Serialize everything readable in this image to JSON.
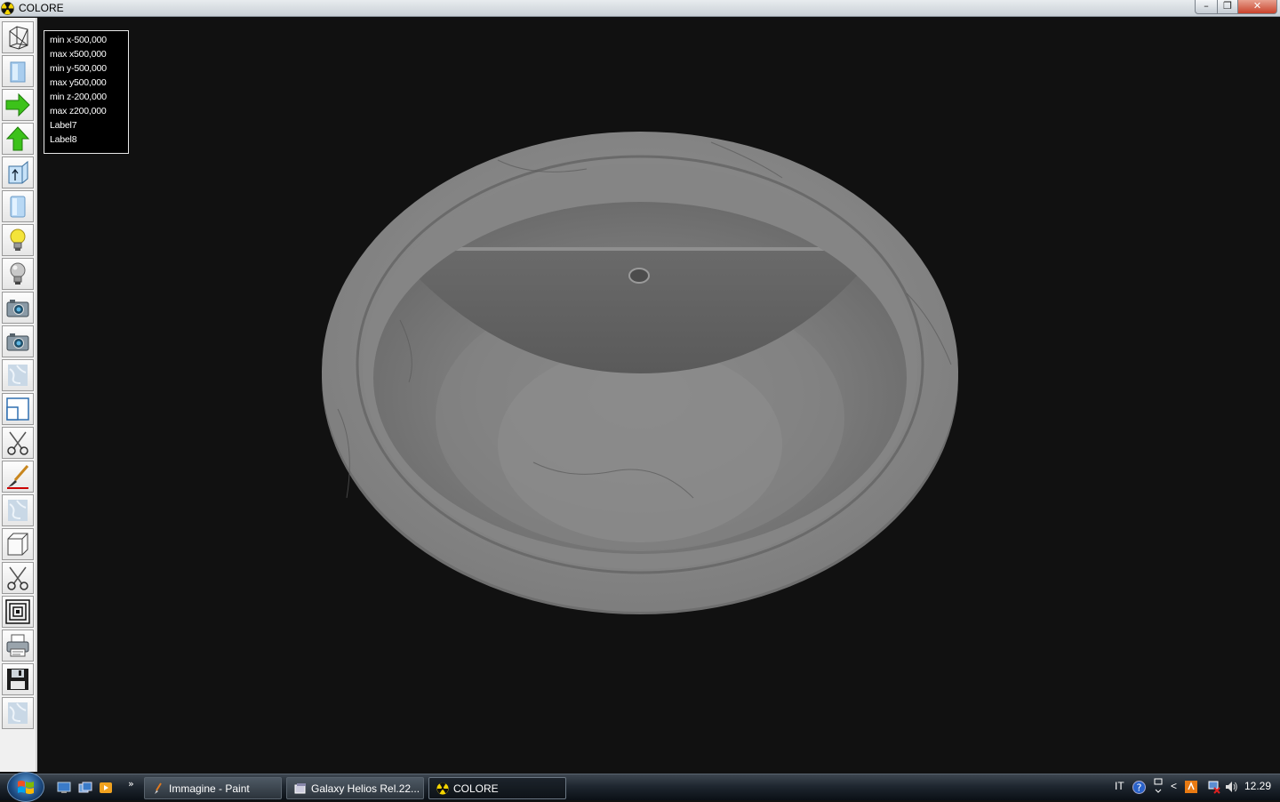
{
  "window": {
    "title": "COLORE",
    "minimize_glyph": "–",
    "maximize_glyph": "❐",
    "close_glyph": "✕"
  },
  "toolbar": {
    "tools": [
      {
        "name": "wireframe-cube-icon"
      },
      {
        "name": "solid-block-icon"
      },
      {
        "name": "arrow-right-icon"
      },
      {
        "name": "arrow-up-icon"
      },
      {
        "name": "box-up-icon"
      },
      {
        "name": "cylinder-icon"
      },
      {
        "name": "lightbulb-on-icon"
      },
      {
        "name": "lightbulb-off-icon"
      },
      {
        "name": "camera-icon"
      },
      {
        "name": "camera-alt-icon"
      },
      {
        "name": "marble-texture-icon"
      },
      {
        "name": "window-layout-icon"
      },
      {
        "name": "scissors-icon"
      },
      {
        "name": "brush-icon"
      },
      {
        "name": "marble-texture-2-icon"
      },
      {
        "name": "cube-outline-icon"
      },
      {
        "name": "scissors-2-icon"
      },
      {
        "name": "concentric-squares-icon"
      },
      {
        "name": "printer-icon"
      },
      {
        "name": "floppy-disk-icon"
      },
      {
        "name": "marble-texture-3-icon"
      }
    ]
  },
  "info_panel": {
    "lines": [
      "min x-500,000",
      "max x500,000",
      "min y-500,000",
      "max y500,000",
      "min z-200,000",
      "max z200,000",
      "Label7",
      "Label8"
    ]
  },
  "taskbar": {
    "quick_launch_more": "»",
    "tasks": [
      {
        "label": "Immagine - Paint",
        "icon": "paint-icon",
        "active": false
      },
      {
        "label": "Galaxy Helios  Rel.22...",
        "icon": "galaxy-helios-icon",
        "active": false
      },
      {
        "label": "COLORE",
        "icon": "radiation-icon",
        "active": true
      }
    ],
    "tray": {
      "language": "IT",
      "show_hidden": "<",
      "clock": "12.29"
    }
  },
  "colors": {
    "toolbar_bg": "#f0f0f0",
    "viewport_bg": "#111111",
    "marble": "#8a8a8a",
    "arrow_green": "#3cc21a",
    "bulb_yellow": "#f4e43a"
  }
}
